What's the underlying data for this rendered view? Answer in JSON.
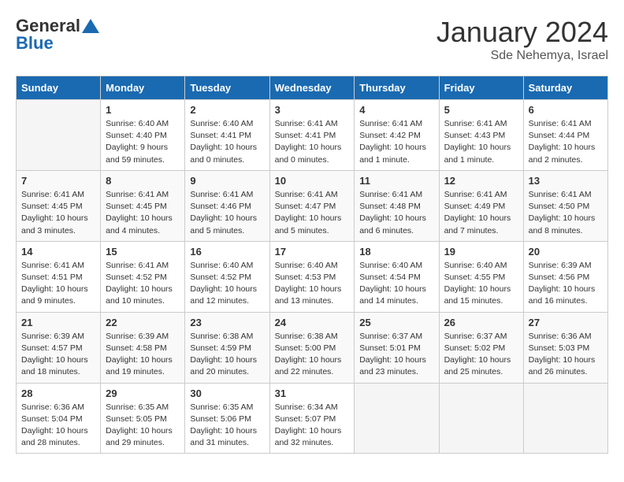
{
  "header": {
    "logo_general": "General",
    "logo_blue": "Blue",
    "month_title": "January 2024",
    "location": "Sde Nehemya, Israel"
  },
  "days_of_week": [
    "Sunday",
    "Monday",
    "Tuesday",
    "Wednesday",
    "Thursday",
    "Friday",
    "Saturday"
  ],
  "weeks": [
    [
      {
        "day": "",
        "info": ""
      },
      {
        "day": "1",
        "info": "Sunrise: 6:40 AM\nSunset: 4:40 PM\nDaylight: 9 hours\nand 59 minutes."
      },
      {
        "day": "2",
        "info": "Sunrise: 6:40 AM\nSunset: 4:41 PM\nDaylight: 10 hours\nand 0 minutes."
      },
      {
        "day": "3",
        "info": "Sunrise: 6:41 AM\nSunset: 4:41 PM\nDaylight: 10 hours\nand 0 minutes."
      },
      {
        "day": "4",
        "info": "Sunrise: 6:41 AM\nSunset: 4:42 PM\nDaylight: 10 hours\nand 1 minute."
      },
      {
        "day": "5",
        "info": "Sunrise: 6:41 AM\nSunset: 4:43 PM\nDaylight: 10 hours\nand 1 minute."
      },
      {
        "day": "6",
        "info": "Sunrise: 6:41 AM\nSunset: 4:44 PM\nDaylight: 10 hours\nand 2 minutes."
      }
    ],
    [
      {
        "day": "7",
        "info": "Sunrise: 6:41 AM\nSunset: 4:45 PM\nDaylight: 10 hours\nand 3 minutes."
      },
      {
        "day": "8",
        "info": "Sunrise: 6:41 AM\nSunset: 4:45 PM\nDaylight: 10 hours\nand 4 minutes."
      },
      {
        "day": "9",
        "info": "Sunrise: 6:41 AM\nSunset: 4:46 PM\nDaylight: 10 hours\nand 5 minutes."
      },
      {
        "day": "10",
        "info": "Sunrise: 6:41 AM\nSunset: 4:47 PM\nDaylight: 10 hours\nand 5 minutes."
      },
      {
        "day": "11",
        "info": "Sunrise: 6:41 AM\nSunset: 4:48 PM\nDaylight: 10 hours\nand 6 minutes."
      },
      {
        "day": "12",
        "info": "Sunrise: 6:41 AM\nSunset: 4:49 PM\nDaylight: 10 hours\nand 7 minutes."
      },
      {
        "day": "13",
        "info": "Sunrise: 6:41 AM\nSunset: 4:50 PM\nDaylight: 10 hours\nand 8 minutes."
      }
    ],
    [
      {
        "day": "14",
        "info": "Sunrise: 6:41 AM\nSunset: 4:51 PM\nDaylight: 10 hours\nand 9 minutes."
      },
      {
        "day": "15",
        "info": "Sunrise: 6:41 AM\nSunset: 4:52 PM\nDaylight: 10 hours\nand 10 minutes."
      },
      {
        "day": "16",
        "info": "Sunrise: 6:40 AM\nSunset: 4:52 PM\nDaylight: 10 hours\nand 12 minutes."
      },
      {
        "day": "17",
        "info": "Sunrise: 6:40 AM\nSunset: 4:53 PM\nDaylight: 10 hours\nand 13 minutes."
      },
      {
        "day": "18",
        "info": "Sunrise: 6:40 AM\nSunset: 4:54 PM\nDaylight: 10 hours\nand 14 minutes."
      },
      {
        "day": "19",
        "info": "Sunrise: 6:40 AM\nSunset: 4:55 PM\nDaylight: 10 hours\nand 15 minutes."
      },
      {
        "day": "20",
        "info": "Sunrise: 6:39 AM\nSunset: 4:56 PM\nDaylight: 10 hours\nand 16 minutes."
      }
    ],
    [
      {
        "day": "21",
        "info": "Sunrise: 6:39 AM\nSunset: 4:57 PM\nDaylight: 10 hours\nand 18 minutes."
      },
      {
        "day": "22",
        "info": "Sunrise: 6:39 AM\nSunset: 4:58 PM\nDaylight: 10 hours\nand 19 minutes."
      },
      {
        "day": "23",
        "info": "Sunrise: 6:38 AM\nSunset: 4:59 PM\nDaylight: 10 hours\nand 20 minutes."
      },
      {
        "day": "24",
        "info": "Sunrise: 6:38 AM\nSunset: 5:00 PM\nDaylight: 10 hours\nand 22 minutes."
      },
      {
        "day": "25",
        "info": "Sunrise: 6:37 AM\nSunset: 5:01 PM\nDaylight: 10 hours\nand 23 minutes."
      },
      {
        "day": "26",
        "info": "Sunrise: 6:37 AM\nSunset: 5:02 PM\nDaylight: 10 hours\nand 25 minutes."
      },
      {
        "day": "27",
        "info": "Sunrise: 6:36 AM\nSunset: 5:03 PM\nDaylight: 10 hours\nand 26 minutes."
      }
    ],
    [
      {
        "day": "28",
        "info": "Sunrise: 6:36 AM\nSunset: 5:04 PM\nDaylight: 10 hours\nand 28 minutes."
      },
      {
        "day": "29",
        "info": "Sunrise: 6:35 AM\nSunset: 5:05 PM\nDaylight: 10 hours\nand 29 minutes."
      },
      {
        "day": "30",
        "info": "Sunrise: 6:35 AM\nSunset: 5:06 PM\nDaylight: 10 hours\nand 31 minutes."
      },
      {
        "day": "31",
        "info": "Sunrise: 6:34 AM\nSunset: 5:07 PM\nDaylight: 10 hours\nand 32 minutes."
      },
      {
        "day": "",
        "info": ""
      },
      {
        "day": "",
        "info": ""
      },
      {
        "day": "",
        "info": ""
      }
    ]
  ]
}
